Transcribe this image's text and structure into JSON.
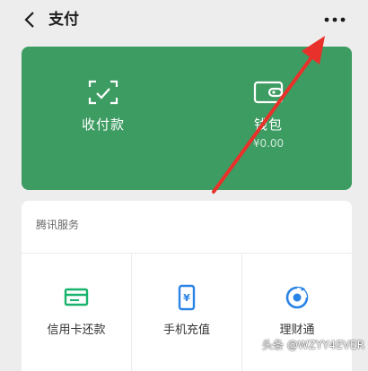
{
  "header": {
    "title": "支付",
    "back_icon": "chevron-left-icon",
    "more_icon": "more-dots-icon"
  },
  "green_card": {
    "color": "#3d9c62",
    "items": [
      {
        "label": "收付款",
        "icon": "scan-qr-icon"
      },
      {
        "label": "钱包",
        "sub": "¥0.00",
        "icon": "wallet-icon"
      }
    ]
  },
  "services": {
    "heading": "腾讯服务",
    "items": [
      {
        "label": "信用卡还款",
        "icon": "credit-card-icon",
        "color": "#19b36b"
      },
      {
        "label": "手机充值",
        "icon": "phone-topup-icon",
        "color": "#2a83e6"
      },
      {
        "label": "理财通",
        "icon": "wealth-icon",
        "color": "#2a83e6"
      }
    ]
  },
  "annotation": {
    "arrow_color": "#e8312a"
  },
  "watermark": "头条 @WZYY4EVER"
}
